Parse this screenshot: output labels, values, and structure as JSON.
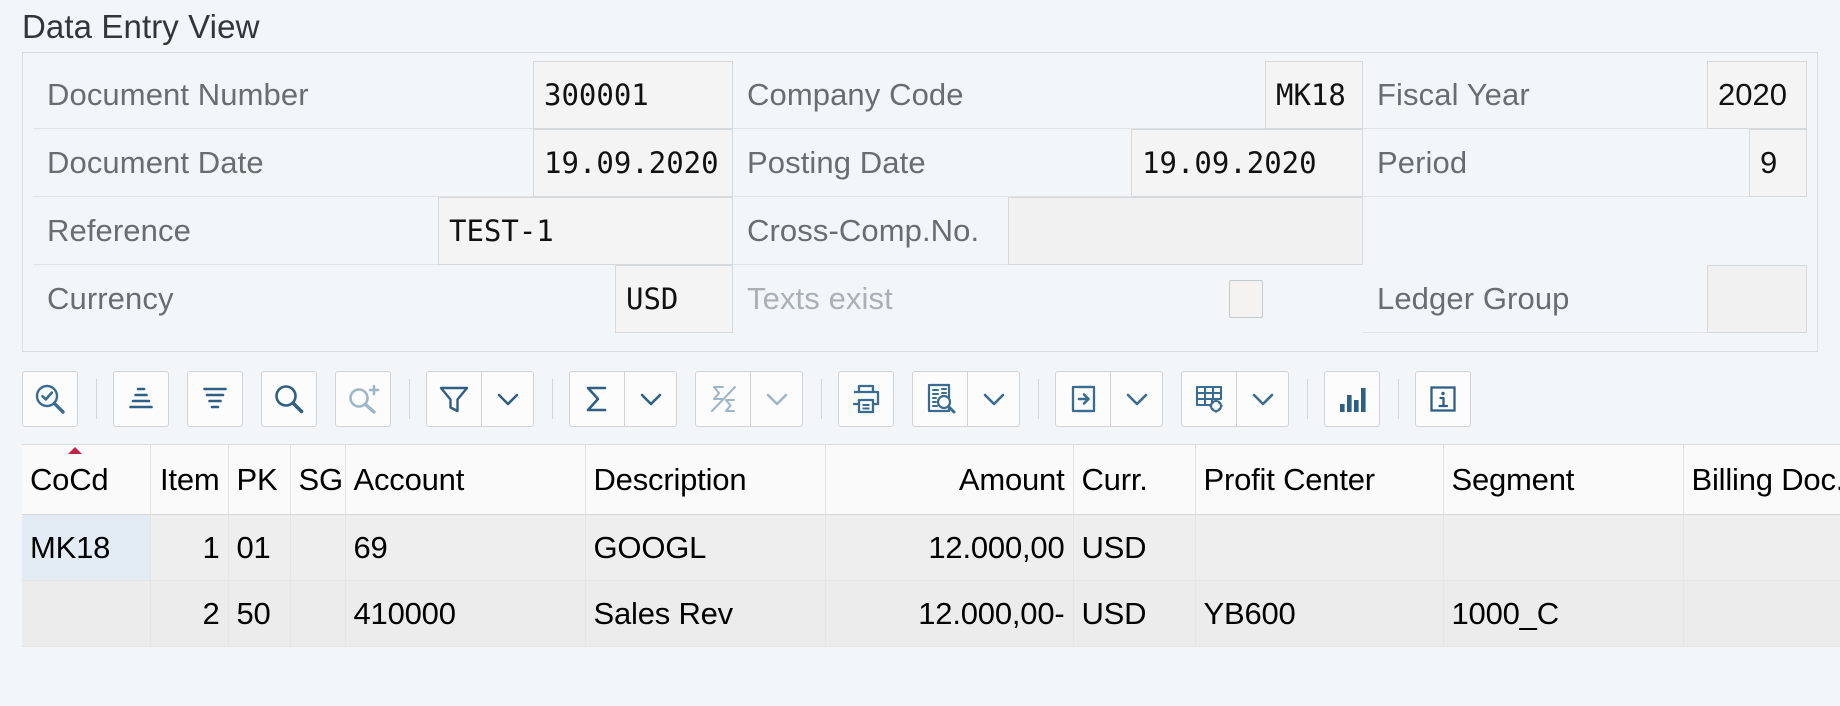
{
  "page": {
    "title": "Data Entry View"
  },
  "form": {
    "fields": {
      "document_number": {
        "label": "Document Number",
        "value": "300001"
      },
      "document_date": {
        "label": "Document Date",
        "value": "19.09.2020"
      },
      "reference": {
        "label": "Reference",
        "value": "TEST-1"
      },
      "currency": {
        "label": "Currency",
        "value": "USD"
      },
      "company_code": {
        "label": "Company Code",
        "value": "MK18"
      },
      "posting_date": {
        "label": "Posting Date",
        "value": "19.09.2020"
      },
      "cross_comp_no": {
        "label": "Cross-Comp.No.",
        "value": ""
      },
      "texts_exist": {
        "label": "Texts exist",
        "checked": false
      },
      "fiscal_year": {
        "label": "Fiscal Year",
        "value": "2020"
      },
      "period": {
        "label": "Period",
        "value": "9"
      },
      "ledger_group": {
        "label": "Ledger Group",
        "value": ""
      }
    }
  },
  "toolbar": {
    "items": [
      {
        "name": "check-magnifier-icon",
        "title": "Display Document"
      },
      {
        "name": "sort-ascending-icon",
        "title": "Sort in Ascending Order"
      },
      {
        "name": "sort-descending-icon",
        "title": "Sort in Descending Order"
      },
      {
        "name": "search-icon",
        "title": "Find"
      },
      {
        "name": "search-plus-icon",
        "title": "Find Next"
      },
      {
        "name": "filter-icon",
        "title": "Set Filter"
      },
      {
        "name": "sum-icon",
        "title": "Total"
      },
      {
        "name": "subtotal-icon",
        "title": "Subtotals"
      },
      {
        "name": "print-icon",
        "title": "Print"
      },
      {
        "name": "preview-icon",
        "title": "Print Preview"
      },
      {
        "name": "export-icon",
        "title": "Export"
      },
      {
        "name": "table-settings-icon",
        "title": "Change Layout"
      },
      {
        "name": "chart-icon",
        "title": "Graphic"
      },
      {
        "name": "info-icon",
        "title": "Information"
      }
    ]
  },
  "grid": {
    "columns": [
      {
        "key": "cocd",
        "label": "CoCd",
        "align": "left",
        "sorted": "asc"
      },
      {
        "key": "item",
        "label": "Item",
        "align": "right"
      },
      {
        "key": "pk",
        "label": "PK",
        "align": "left"
      },
      {
        "key": "sg",
        "label": "SG",
        "align": "left"
      },
      {
        "key": "account",
        "label": "Account",
        "align": "left"
      },
      {
        "key": "desc",
        "label": "Description",
        "align": "left"
      },
      {
        "key": "amount",
        "label": "Amount",
        "align": "right"
      },
      {
        "key": "curr",
        "label": "Curr.",
        "align": "left"
      },
      {
        "key": "profit",
        "label": "Profit Center",
        "align": "left"
      },
      {
        "key": "segment",
        "label": "Segment",
        "align": "left"
      },
      {
        "key": "billing",
        "label": "Billing Doc.",
        "align": "left"
      }
    ],
    "rows": [
      {
        "cocd": "MK18",
        "item": "1",
        "pk": "01",
        "sg": "",
        "account": "69",
        "desc": "GOOGL",
        "amount": "12.000,00",
        "curr": "USD",
        "profit": "",
        "segment": "",
        "billing": "",
        "selected_cell": "cocd"
      },
      {
        "cocd": "",
        "item": "2",
        "pk": "50",
        "sg": "",
        "account": "410000",
        "desc": "Sales Rev",
        "amount": "12.000,00-",
        "curr": "USD",
        "profit": "YB600",
        "segment": "1000_C",
        "billing": ""
      }
    ]
  },
  "colors": {
    "background": "#f2f6f9",
    "icon_blue": "#3a6b91",
    "icon_disabled": "#a8bccd",
    "sort_marker": "#c0264a",
    "selected_cell": "#e3ecf5"
  }
}
